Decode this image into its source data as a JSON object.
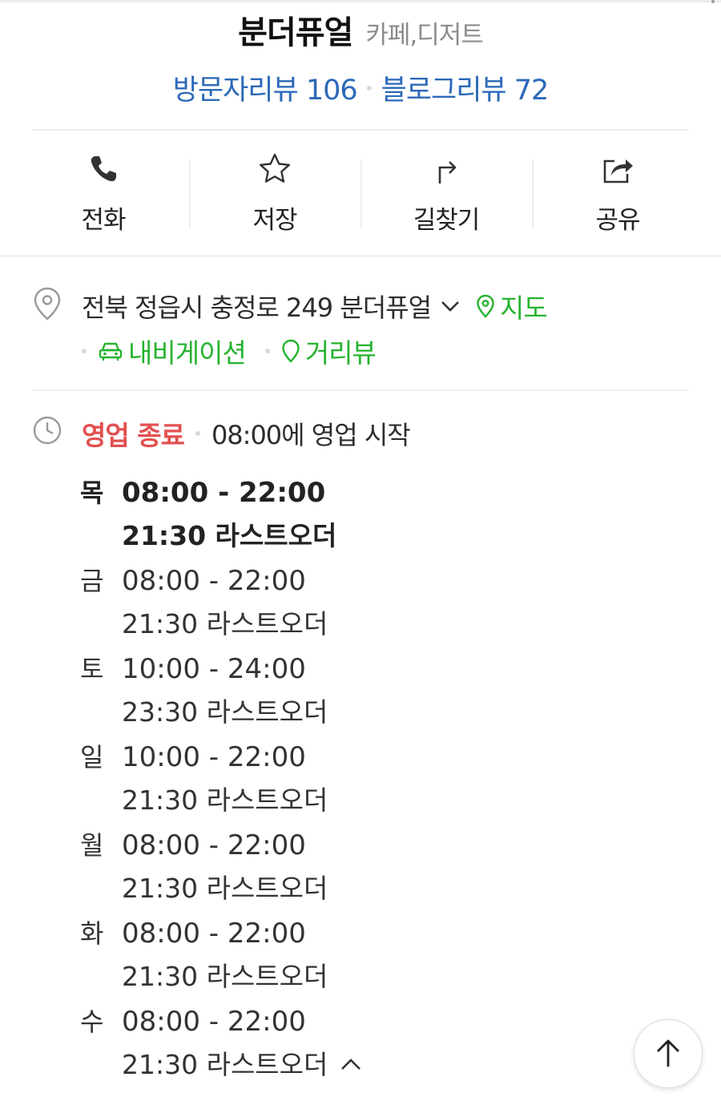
{
  "place": {
    "name": "분더퓨얼",
    "category": "카페,디저트",
    "visitor_reviews": "방문자리뷰 106",
    "blog_reviews": "블로그리뷰 72"
  },
  "actions": [
    {
      "label": "전화",
      "icon": "phone-icon"
    },
    {
      "label": "저장",
      "icon": "star-icon"
    },
    {
      "label": "길찾기",
      "icon": "directions-icon"
    },
    {
      "label": "공유",
      "icon": "share-icon"
    }
  ],
  "address": {
    "text": "전북 정읍시 충정로 249 분더퓨얼",
    "map_label": "지도",
    "navigation_label": "내비게이션",
    "street_view_label": "거리뷰"
  },
  "business_status": {
    "status": "영업 종료",
    "next_open": "08:00에 영업 시작"
  },
  "hours": [
    {
      "day": "목",
      "hours": "08:00 - 22:00",
      "last_order": "21:30 라스트오더",
      "today": true
    },
    {
      "day": "금",
      "hours": "08:00 - 22:00",
      "last_order": "21:30 라스트오더"
    },
    {
      "day": "토",
      "hours": "10:00 - 24:00",
      "last_order": "23:30 라스트오더"
    },
    {
      "day": "일",
      "hours": "10:00 - 22:00",
      "last_order": "21:30 라스트오더"
    },
    {
      "day": "월",
      "hours": "08:00 - 22:00",
      "last_order": "21:30 라스트오더"
    },
    {
      "day": "화",
      "hours": "08:00 - 22:00",
      "last_order": "21:30 라스트오더"
    },
    {
      "day": "수",
      "hours": "08:00 - 22:00",
      "last_order": "21:30 라스트오더"
    }
  ],
  "colors": {
    "review_link": "#2b69b8",
    "green_link": "#27b32f",
    "closed_status": "#e35050"
  }
}
